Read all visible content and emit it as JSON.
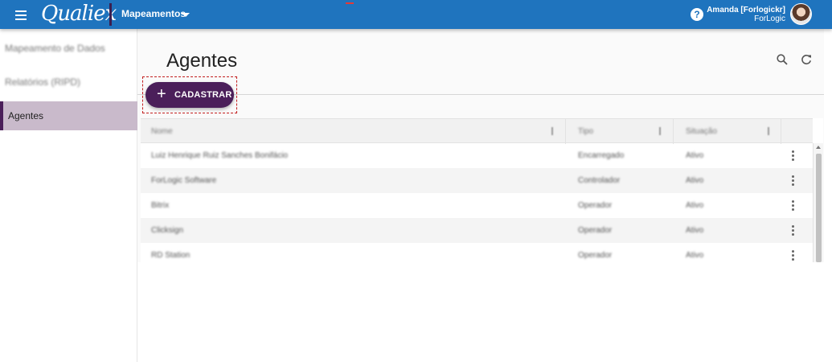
{
  "header": {
    "brand": "Qualiex",
    "module": "Mapeamentos",
    "user_name": "Amanda [Forlogickr]",
    "user_org": "ForLogic",
    "help_glyph": "?",
    "bar_color": "#1f74be",
    "icons": [
      "menu-icon",
      "chevron-down-icon",
      "help-icon",
      "avatar"
    ]
  },
  "sidebar": {
    "items": [
      {
        "label": "Mapeamento de Dados",
        "active": false
      },
      {
        "label": "Relatórios (RIPD)",
        "active": false
      },
      {
        "label": "Agentes",
        "active": true
      }
    ],
    "active_color": "#c9bacb"
  },
  "main": {
    "title": "Agentes",
    "cadastrar": {
      "plus": "+",
      "label": "CADASTRAR",
      "color": "#4b1f5a"
    },
    "icons": [
      "search-icon",
      "refresh-icon"
    ]
  },
  "table": {
    "columns": [
      "Nome",
      "Tipo",
      "Situação"
    ],
    "rows": [
      {
        "nome": "Luiz Henrique Ruiz Sanches Bonifácio",
        "tipo": "Encarregado",
        "situacao": "Ativo"
      },
      {
        "nome": "ForLogic Software",
        "tipo": "Controlador",
        "situacao": "Ativo"
      },
      {
        "nome": "Bitrix",
        "tipo": "Operador",
        "situacao": "Ativo"
      },
      {
        "nome": "Clicksign",
        "tipo": "Operador",
        "situacao": "Ativo"
      },
      {
        "nome": "RD Station",
        "tipo": "Operador",
        "situacao": "Ativo"
      }
    ]
  }
}
